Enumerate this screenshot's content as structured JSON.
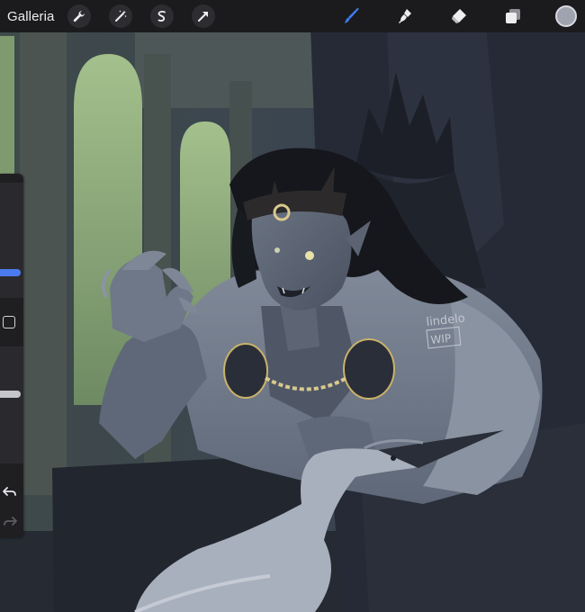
{
  "toolbar": {
    "gallery_label": "Galleria",
    "left_tools": [
      "wrench-icon",
      "magic-wand-icon",
      "selection-icon",
      "transform-arrow-icon"
    ],
    "right_tools": [
      "brush-icon",
      "smudge-icon",
      "eraser-icon",
      "layers-icon"
    ],
    "active_tool": "brush-icon",
    "active_tool_color": "#3f7cf2",
    "current_color": "#9fa3b0"
  },
  "sidebar": {
    "brush_size_level": 0.2,
    "brush_opacity_level": 0.6,
    "size_accent": "#4c7bf0",
    "opacity_accent": "#c4c6cc"
  },
  "artwork": {
    "signature_line1": "lindelo",
    "signature_line2": "WIP"
  }
}
